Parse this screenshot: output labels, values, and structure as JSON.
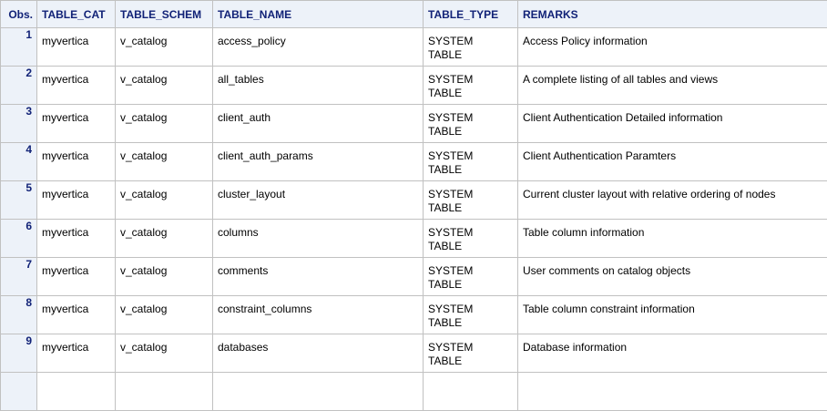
{
  "columns": {
    "obs": "Obs.",
    "table_cat": "TABLE_CAT",
    "table_schem": "TABLE_SCHEM",
    "table_name": "TABLE_NAME",
    "table_type": "TABLE_TYPE",
    "remarks": "REMARKS"
  },
  "rows": [
    {
      "obs": "1",
      "table_cat": "myvertica",
      "table_schem": "v_catalog",
      "table_name": "access_policy",
      "table_type_1": "SYSTEM",
      "table_type_2": "TABLE",
      "remarks": "Access Policy information"
    },
    {
      "obs": "2",
      "table_cat": "myvertica",
      "table_schem": "v_catalog",
      "table_name": "all_tables",
      "table_type_1": "SYSTEM",
      "table_type_2": "TABLE",
      "remarks": "A complete listing of all tables and views"
    },
    {
      "obs": "3",
      "table_cat": "myvertica",
      "table_schem": "v_catalog",
      "table_name": "client_auth",
      "table_type_1": "SYSTEM",
      "table_type_2": "TABLE",
      "remarks": "Client Authentication Detailed information"
    },
    {
      "obs": "4",
      "table_cat": "myvertica",
      "table_schem": "v_catalog",
      "table_name": "client_auth_params",
      "table_type_1": "SYSTEM",
      "table_type_2": "TABLE",
      "remarks": "Client Authentication Paramters"
    },
    {
      "obs": "5",
      "table_cat": "myvertica",
      "table_schem": "v_catalog",
      "table_name": "cluster_layout",
      "table_type_1": "SYSTEM",
      "table_type_2": "TABLE",
      "remarks": "Current cluster layout with relative ordering of nodes"
    },
    {
      "obs": "6",
      "table_cat": "myvertica",
      "table_schem": "v_catalog",
      "table_name": "columns",
      "table_type_1": "SYSTEM",
      "table_type_2": "TABLE",
      "remarks": "Table column information"
    },
    {
      "obs": "7",
      "table_cat": "myvertica",
      "table_schem": "v_catalog",
      "table_name": "comments",
      "table_type_1": "SYSTEM",
      "table_type_2": "TABLE",
      "remarks": "User comments on catalog objects"
    },
    {
      "obs": "8",
      "table_cat": "myvertica",
      "table_schem": "v_catalog",
      "table_name": "constraint_columns",
      "table_type_1": "SYSTEM",
      "table_type_2": "TABLE",
      "remarks": "Table column constraint information"
    },
    {
      "obs": "9",
      "table_cat": "myvertica",
      "table_schem": "v_catalog",
      "table_name": "databases",
      "table_type_1": "SYSTEM",
      "table_type_2": "TABLE",
      "remarks": "Database information"
    },
    {
      "obs": "",
      "table_cat": "",
      "table_schem": "",
      "table_name": "",
      "table_type_1": "",
      "table_type_2": "",
      "remarks": ""
    }
  ],
  "colors": {
    "header_bg": "#edf2f9",
    "header_text": "#112277",
    "grid": "#c1c1c1"
  }
}
